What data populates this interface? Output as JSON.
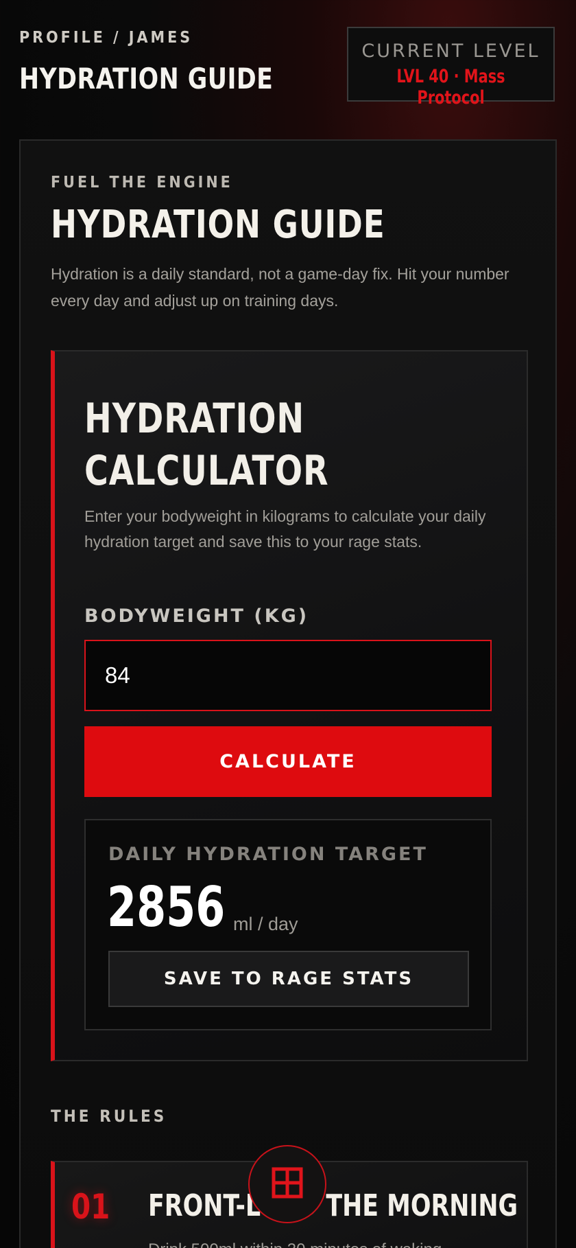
{
  "header": {
    "breadcrumb": "PROFILE / JAMES",
    "title": "HYDRATION GUIDE",
    "level_label": "CURRENT LEVEL",
    "level_value": "LVL 40 · Mass Protocol"
  },
  "guide": {
    "eyebrow": "FUEL THE ENGINE",
    "title": "HYDRATION GUIDE",
    "intro": "Hydration is a daily standard, not a game-day fix. Hit your number every day and adjust up on training days."
  },
  "calculator": {
    "title_line1": "HYDRATION",
    "title_line2": "CALCULATOR",
    "description": "Enter your bodyweight in kilograms to calculate your daily hydration target and save this to your rage stats.",
    "field_label": "BODYWEIGHT (KG)",
    "bodyweight_value": "84",
    "calculate_label": "CALCULATE",
    "result_label": "DAILY HYDRATION TARGET",
    "result_value": "2856",
    "result_unit": "ml / day",
    "save_label": "SAVE TO RAGE STATS"
  },
  "rules": {
    "label": "THE RULES",
    "items": [
      {
        "number": "01",
        "title": "FRONT-LOAD THE MORNING",
        "description": "Drink 500ml within 30 minutes of waking"
      }
    ]
  },
  "fab": {
    "icon": "grid-icon"
  },
  "colors": {
    "accent": "#de0b0f",
    "background": "#0a0a0a",
    "text": "#f1efe9"
  }
}
